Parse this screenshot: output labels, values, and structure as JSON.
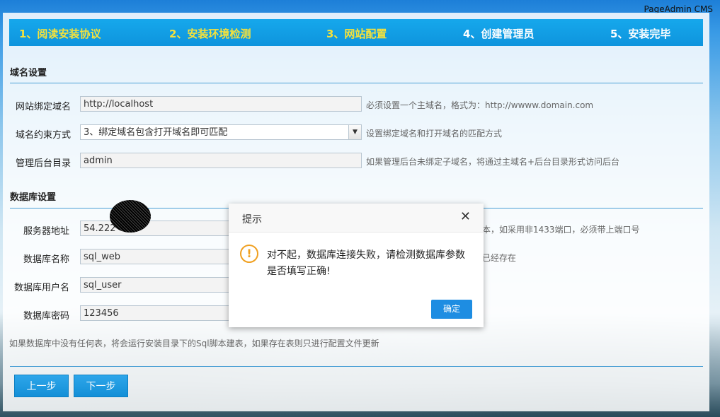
{
  "brand": "PageAdmin CMS",
  "steps": [
    {
      "label": "1、阅读安装协议",
      "status": "done"
    },
    {
      "label": "2、安装环境检测",
      "status": "done"
    },
    {
      "label": "3、网站配置",
      "status": "current"
    },
    {
      "label": "4、创建管理员",
      "status": "todo"
    },
    {
      "label": "5、安装完毕",
      "status": "todo"
    }
  ],
  "domain_section": {
    "title": "域名设置",
    "fields": [
      {
        "label": "网站绑定域名",
        "value": "http://localhost",
        "hint": "必须设置一个主域名，格式为：http://wwww.domain.com"
      },
      {
        "label": "域名约束方式",
        "value": "3、绑定域名包含打开域名即可匹配",
        "hint": "设置绑定域名和打开域名的匹配方式"
      },
      {
        "label": "管理后台目录",
        "value": "admin",
        "hint": "如果管理后台未绑定子域名，将通过主域名+后台目录形式访问后台"
      }
    ]
  },
  "db_section": {
    "title": "数据库设置",
    "fields": [
      {
        "label": "服务器地址",
        "value": "54.222",
        "hint": "本，如采用非1433端口，必须带上端口号"
      },
      {
        "label": "数据库名称",
        "value": "sql_web",
        "hint": "已经存在"
      },
      {
        "label": "数据库用户名",
        "value": "sql_user",
        "hint": ""
      },
      {
        "label": "数据库密码",
        "value": "123456",
        "hint": ""
      }
    ],
    "note": "如果数据库中没有任何表，将会运行安装目录下的Sql脚本建表，如果存在表则只进行配置文件更新"
  },
  "buttons": {
    "prev": "上一步",
    "next": "下一步"
  },
  "dialog": {
    "title": "提示",
    "close": "✕",
    "icon": "!",
    "message": "对不起，数据库连接失败，请检测数据库参数是否填写正确!",
    "ok": "确定"
  },
  "colors": {
    "accent": "#1e8de2",
    "step_done": "#f7e23a",
    "warning": "#f0a020"
  }
}
